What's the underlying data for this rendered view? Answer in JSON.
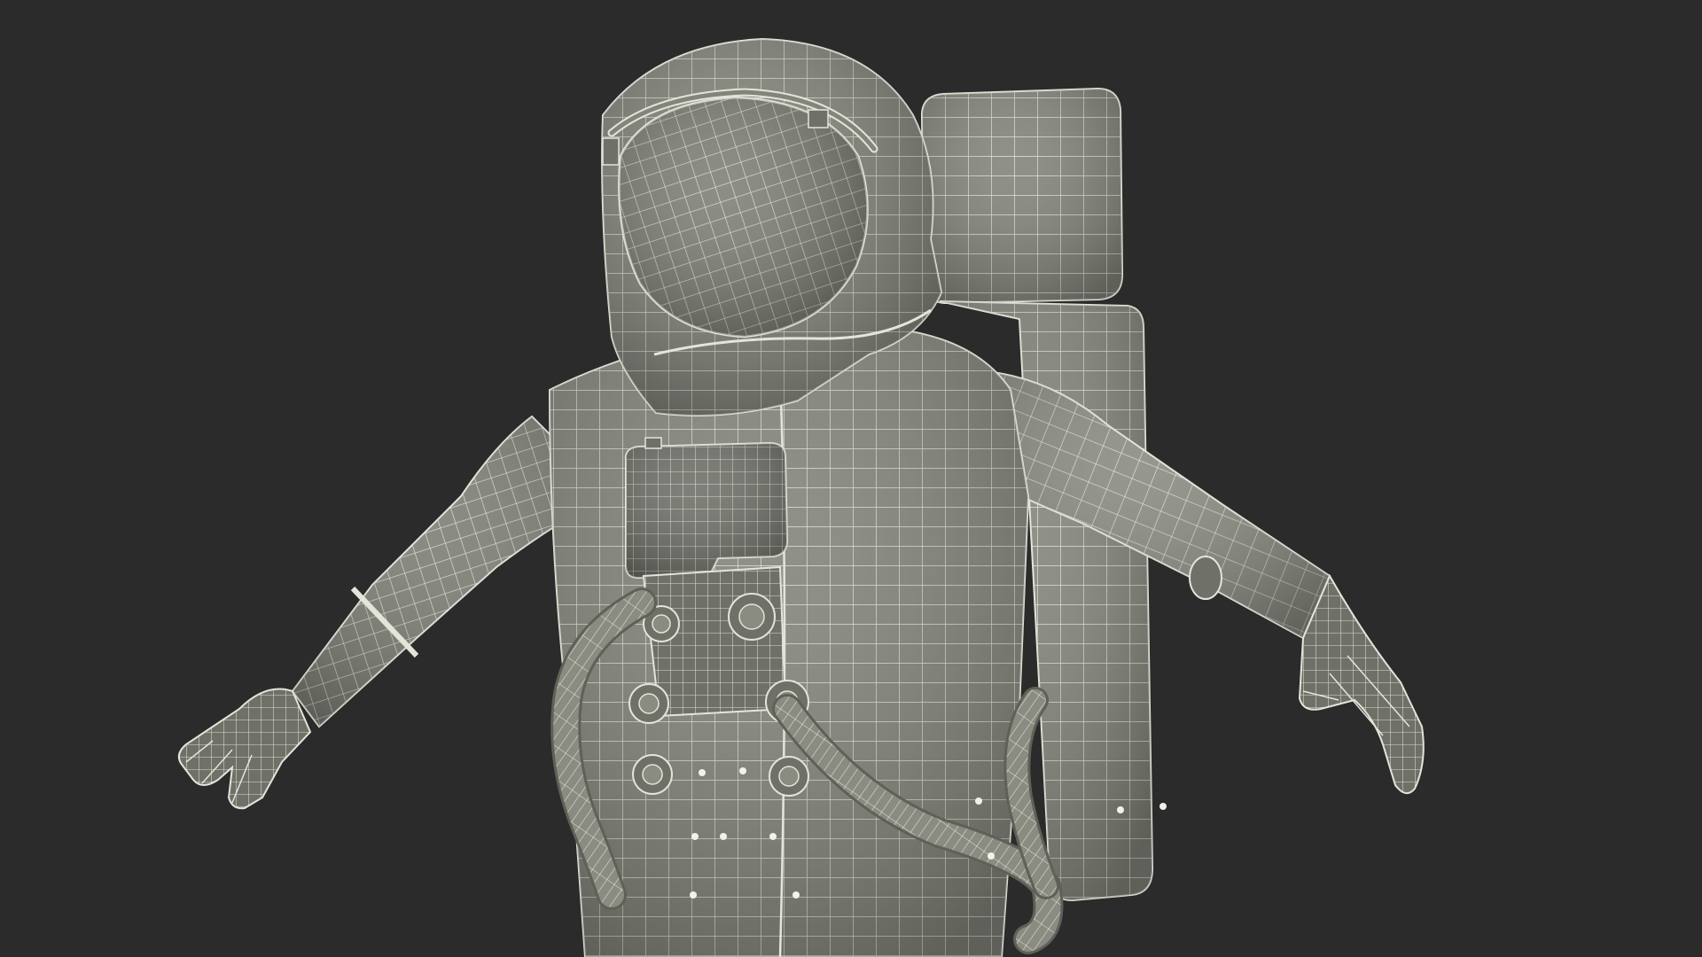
{
  "scene": {
    "subject": "astronaut-wireframe-model",
    "colors": {
      "background": "#2b2b2b",
      "shell": "#83857b",
      "shell_light": "#94968c",
      "shell_dark": "#5f6159",
      "wire": "#e4e4da"
    }
  }
}
